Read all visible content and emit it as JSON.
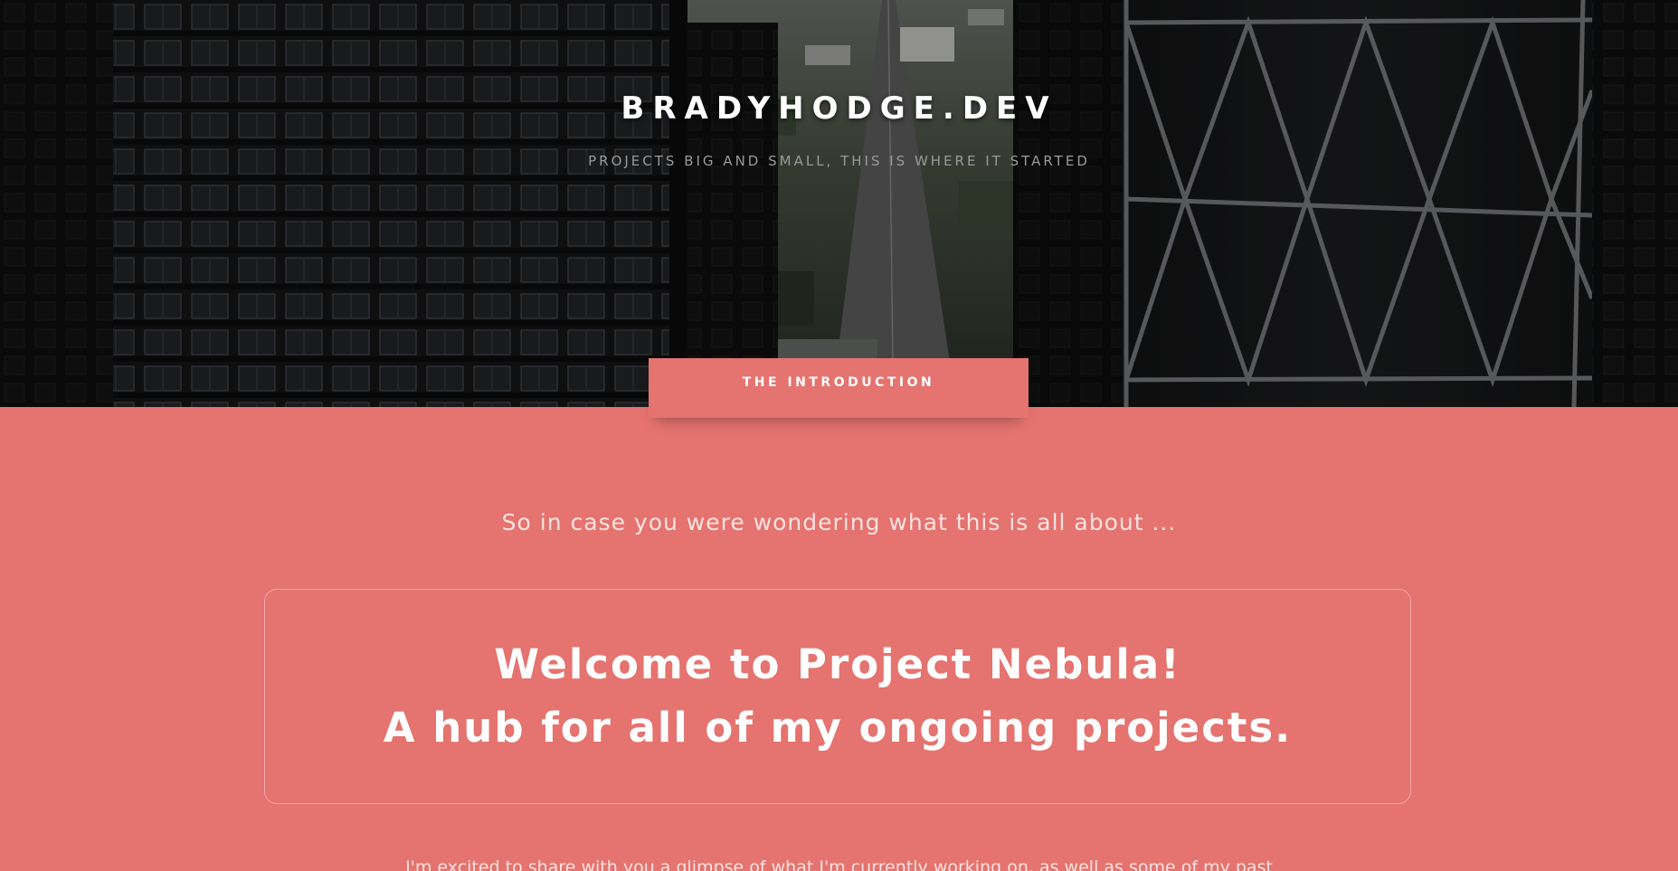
{
  "hero": {
    "title": "BRADYHODGE.DEV",
    "tagline": "PROJECTS BIG AND SMALL, THIS IS WHERE IT STARTED"
  },
  "intro": {
    "tab_label": "THE INTRODUCTION",
    "lead": "So in case you were wondering what this is all about ...",
    "welcome_line_1": "Welcome to Project Nebula!",
    "welcome_line_2": "A hub for all of my ongoing projects.",
    "body_start": "I'm excited to share with you a glimpse of what I'm currently working on, as well as some of my past"
  },
  "colors": {
    "accent": "#e5736f",
    "hero_dark": "#151515",
    "text_light": "#fbe3e1"
  }
}
